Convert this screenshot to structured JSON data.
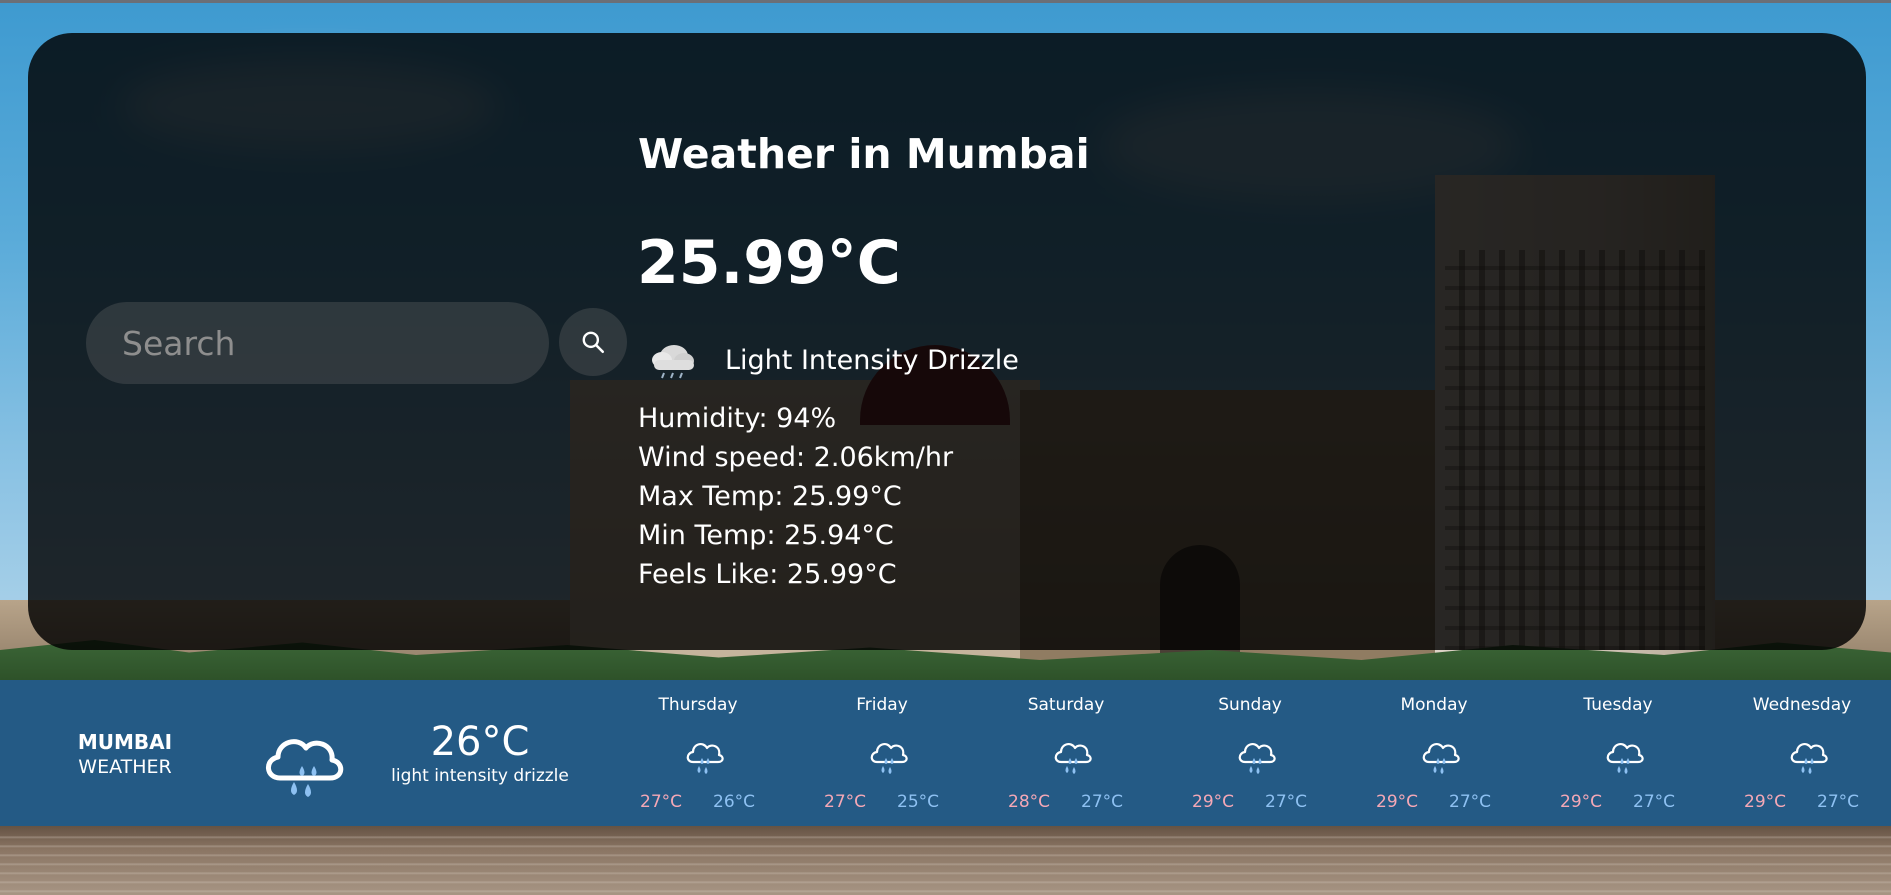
{
  "search": {
    "placeholder": "Search",
    "button_icon": "search-icon"
  },
  "current": {
    "title": "Weather in Mumbai",
    "temperature": "25.99°C",
    "condition": "Light Intensity Drizzle",
    "condition_icon": "cloud-drizzle-icon",
    "details": [
      "Humidity: 94%",
      "Wind speed: 2.06km/hr",
      "Max Temp: 25.99°C",
      "Min Temp: 25.94°C",
      "Feels Like: 25.99°C"
    ]
  },
  "forecast": {
    "city": "MUMBAI",
    "subtitle": "WEATHER",
    "icon": "cloud-rain-icon",
    "now_temp": "26°C",
    "now_desc": "light intensity drizzle",
    "colors": {
      "bar": "#245a85",
      "high": "#f5a8b6",
      "low": "#8ec1f2"
    },
    "days": [
      {
        "day": "Thursday",
        "high": "27°C",
        "low": "26°C",
        "icon": "cloud-rain-icon"
      },
      {
        "day": "Friday",
        "high": "27°C",
        "low": "25°C",
        "icon": "cloud-rain-icon"
      },
      {
        "day": "Saturday",
        "high": "28°C",
        "low": "27°C",
        "icon": "cloud-rain-icon"
      },
      {
        "day": "Sunday",
        "high": "29°C",
        "low": "27°C",
        "icon": "cloud-rain-icon"
      },
      {
        "day": "Monday",
        "high": "29°C",
        "low": "27°C",
        "icon": "cloud-rain-icon"
      },
      {
        "day": "Tuesday",
        "high": "29°C",
        "low": "27°C",
        "icon": "cloud-rain-icon"
      },
      {
        "day": "Wednesday",
        "high": "29°C",
        "low": "27°C",
        "icon": "cloud-rain-icon"
      }
    ]
  }
}
